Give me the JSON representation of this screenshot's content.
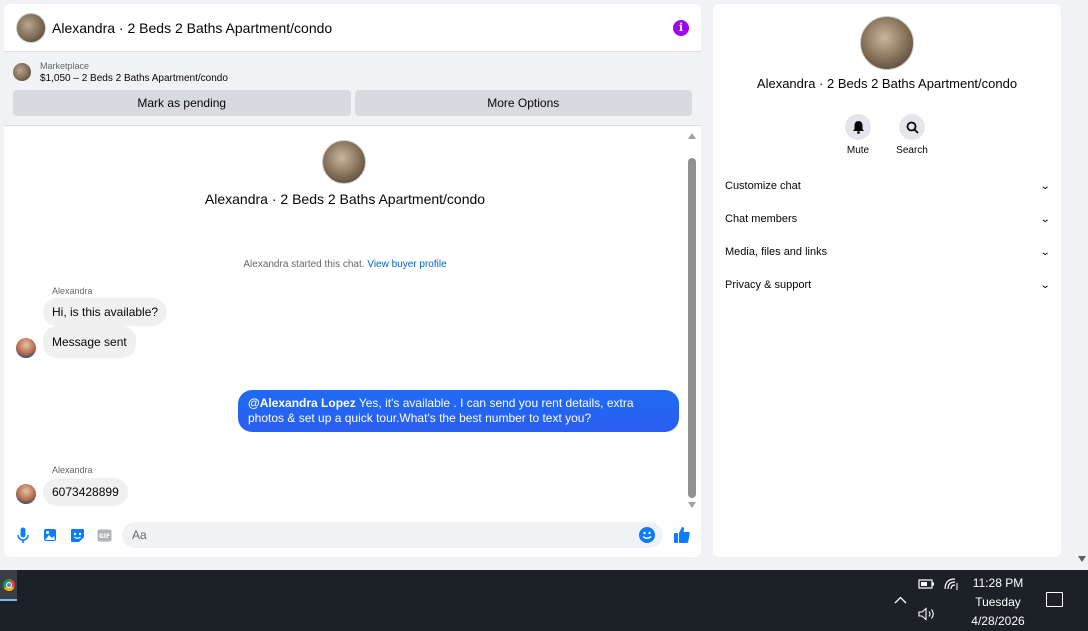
{
  "chat": {
    "header_title": "Alexandra · 2 Beds 2 Baths Apartment/condo",
    "marketplace_label": "Marketplace",
    "listing": "$1,050 – 2 Beds 2 Baths Apartment/condo",
    "mark_pending_label": "Mark as pending",
    "more_options_label": "More Options",
    "conversation_title": "Alexandra · 2 Beds 2 Baths Apartment/condo",
    "started_text": "Alexandra started this chat.",
    "view_buyer_profile": "View buyer profile",
    "messages": [
      {
        "sender": "Alexandra",
        "text": "Hi, is this available?"
      },
      {
        "text": "Message sent"
      },
      {
        "mention": "@Alexandra Lopez",
        "text": " Yes, it's available .  I can send you rent details, extra photos & set up a quick tour.What's the best number to text you?"
      },
      {
        "sender": "Alexandra",
        "text": "6073428899"
      }
    ],
    "input_placeholder": "Aa"
  },
  "info_panel": {
    "title": "Alexandra · 2 Beds 2 Baths Apartment/condo",
    "mute_label": "Mute",
    "search_label": "Search",
    "sections": [
      "Customize chat",
      "Chat members",
      "Media, files and links",
      "Privacy & support"
    ]
  },
  "taskbar": {
    "time": "11:28 PM",
    "day": "Tuesday",
    "date": "4/28/2026"
  },
  "colors": {
    "accent": "#0a7cff",
    "info_icon": "#9f06e8",
    "outgoing_bubble": "#2b5ef0"
  }
}
